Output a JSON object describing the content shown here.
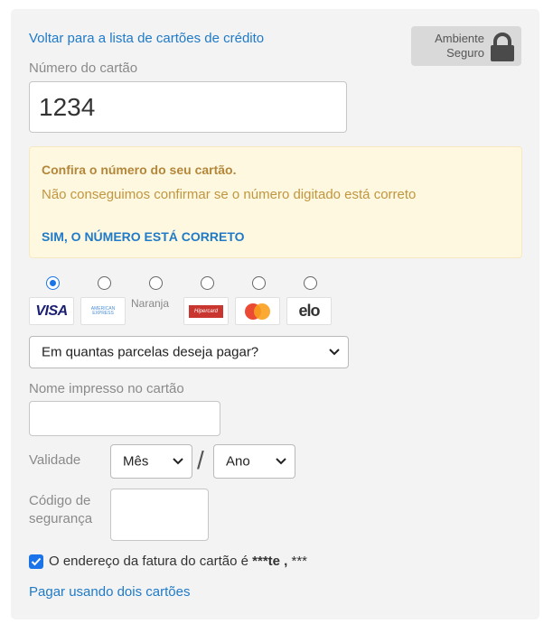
{
  "header": {
    "back_link": "Voltar para a lista de cartões de crédito",
    "secure_line1": "Ambiente",
    "secure_line2": "Seguro"
  },
  "card_number": {
    "label": "Número do cartão",
    "value": "1234"
  },
  "warning": {
    "title": "Confira o número do seu cartão.",
    "message": "Não conseguimos confirmar se o número digitado está correto",
    "confirm_link": "SIM, O NÚMERO ESTÁ CORRETO"
  },
  "card_brands": {
    "selected": "visa",
    "items": [
      {
        "id": "visa",
        "text": "VISA"
      },
      {
        "id": "amex",
        "text_line1": "AMERICAN",
        "text_line2": "EXPRESS"
      },
      {
        "id": "naranja",
        "text": "Naranja"
      },
      {
        "id": "hipercard",
        "text": "Hipercard"
      },
      {
        "id": "mastercard"
      },
      {
        "id": "elo",
        "text": "elo"
      }
    ]
  },
  "installments": {
    "selected": "Em quantas parcelas deseja pagar?"
  },
  "card_name": {
    "label": "Nome impresso no cartão",
    "value": ""
  },
  "expiry": {
    "label": "Validade",
    "month_selected": "Mês",
    "separator": "/",
    "year_selected": "Ano"
  },
  "security_code": {
    "label_line1": "Código de",
    "label_line2": "segurança",
    "value": ""
  },
  "billing_address": {
    "checked": true,
    "text": "O endereço da fatura do cartão é ",
    "masked_bold": "***te ,",
    "masked_rest": " ***"
  },
  "footer": {
    "two_cards_link": "Pagar usando dois cartões"
  },
  "colors": {
    "link": "#1f7ac7",
    "warning_bg": "#fff8e1",
    "accent": "#1a73e8"
  }
}
